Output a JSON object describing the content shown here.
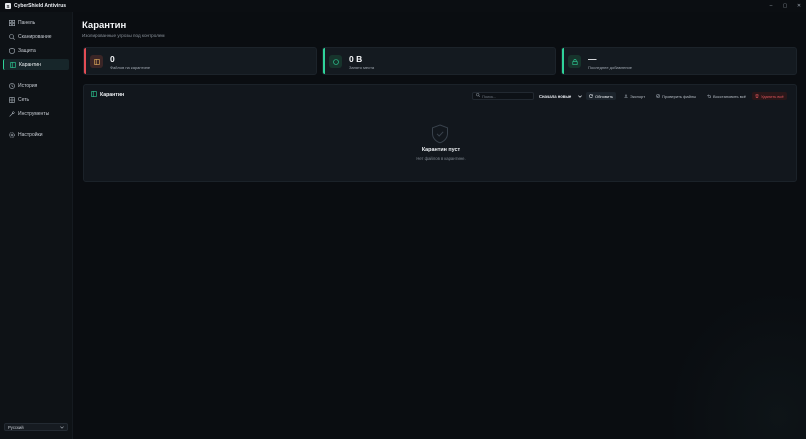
{
  "app": {
    "title": "CyberShield Antivirus",
    "logo_letter": "S"
  },
  "window_controls": {
    "minimize": "–",
    "maximize": "▢",
    "close": "✕"
  },
  "sidebar": {
    "items": [
      {
        "label": "Панель",
        "icon": "grid-icon"
      },
      {
        "label": "Сканирование",
        "icon": "search-icon"
      },
      {
        "label": "Защита",
        "icon": "shield-icon"
      },
      {
        "label": "Карантин",
        "icon": "archive-icon",
        "active": true
      },
      {
        "label": "История",
        "icon": "clock-icon"
      },
      {
        "label": "Сеть",
        "icon": "network-icon"
      },
      {
        "label": "Инструменты",
        "icon": "wrench-icon"
      },
      {
        "label": "Настройки",
        "icon": "gear-icon"
      }
    ],
    "language": "Русский"
  },
  "page": {
    "title": "Карантин",
    "subtitle": "Изолированные угрозы под контролем"
  },
  "stats": [
    {
      "value": "0",
      "caption": "Файлов на карантине",
      "color": "#e24c54",
      "icon": "archive-icon"
    },
    {
      "value": "0 B",
      "caption": "Занято места",
      "color": "#2fd39a",
      "icon": "disk-icon"
    },
    {
      "value": "—",
      "caption": "Последнее добавление",
      "color": "#2fd39a",
      "icon": "lock-icon"
    }
  ],
  "panel": {
    "title": "Карантин",
    "search_placeholder": "Поиск...",
    "sort_value": "Сначала новые",
    "buttons": {
      "refresh": "Обновить",
      "export": "Экспорт",
      "check": "Проверить файлы",
      "restore_all": "Восстановить всё",
      "delete_all": "Удалить всё"
    },
    "empty_title": "Карантин пуст",
    "empty_subtitle": "Нет файлов в карантине."
  },
  "colors": {
    "accent": "#2fd39a",
    "danger": "#e24c54",
    "background": "#0a0d11",
    "card": "#141a20"
  }
}
